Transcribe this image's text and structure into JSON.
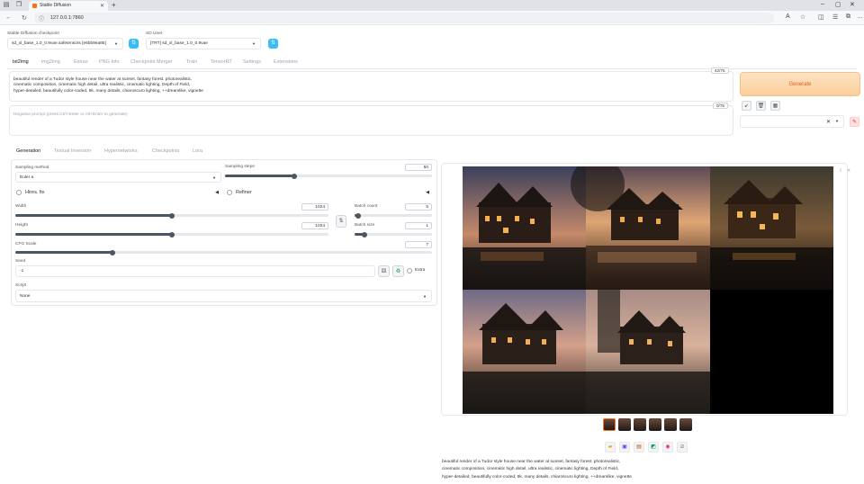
{
  "browser": {
    "tab_title": "Stable Diffusion",
    "url": "127.0.0.1:7860"
  },
  "checkpoint": {
    "label": "Stable Diffusion checkpoint",
    "value": "sd_xl_base_1.0_0.9vae.safetensors [e6bb9ea85]"
  },
  "sd_unet": {
    "label": "SD Unet",
    "value": "[TRT] sd_xl_base_1.0_0.9vae"
  },
  "tabs": [
    "txt2img",
    "img2img",
    "Extras",
    "PNG Info",
    "Checkpoint Merger",
    "Train",
    "TensorRT",
    "Settings",
    "Extensions"
  ],
  "prompt": {
    "text": "beautiful render of a Tudor style house near the water at sunset, fantasy forest. photorealistic,\ncinematic composition, cinematic high detail, ultra realistic, cinematic lighting, Depth of Field,\nhyper-detailed, beautifully color-coded, 8k, many details, chiaroscuro lighting, ++dreamlike, vignette",
    "counter": "42/75"
  },
  "negative_prompt": {
    "placeholder": "Negative prompt (press Ctrl+Enter or Alt+Enter to generate)",
    "counter": "0/75"
  },
  "generate_label": "Generate",
  "subtabs": [
    "Generation",
    "Textual Inversion",
    "Hypernetworks",
    "Checkpoints",
    "Lora"
  ],
  "params": {
    "sampling_method_label": "Sampling method",
    "sampling_method": "Euler a",
    "sampling_steps_label": "Sampling steps",
    "sampling_steps": 50,
    "sampling_steps_max": 150,
    "hires_fix_label": "Hires. fix",
    "refiner_label": "Refiner",
    "width_label": "Width",
    "width": 1024,
    "width_max": 2048,
    "height_label": "Height",
    "height": 1024,
    "height_max": 2048,
    "batch_count_label": "Batch count",
    "batch_count": 5,
    "batch_count_max": 100,
    "batch_size_label": "Batch size",
    "batch_size": 1,
    "batch_size_max": 8,
    "cfg_label": "CFG Scale",
    "cfg": 7,
    "cfg_max": 30,
    "seed_label": "Seed",
    "seed": "-1",
    "extra_label": "Extra",
    "script_label": "Script",
    "script": "None"
  },
  "output_info": "beautiful render of a Tudor style house near the water at sunset, fantasy forest. photorealistic,\ncinematic composition, cinematic high detail, ultra realistic, cinematic lighting, Depth of Field,\nhyper-detailed, beautifully color-coded, 8k, many details, chiaroscuro lighting, ++dreamlike, vignette",
  "colors": {
    "accent": "#f97316",
    "generate_bg": "#fcd9b0",
    "slider": "#4b5563",
    "refresh_button": "#38bdf8"
  }
}
